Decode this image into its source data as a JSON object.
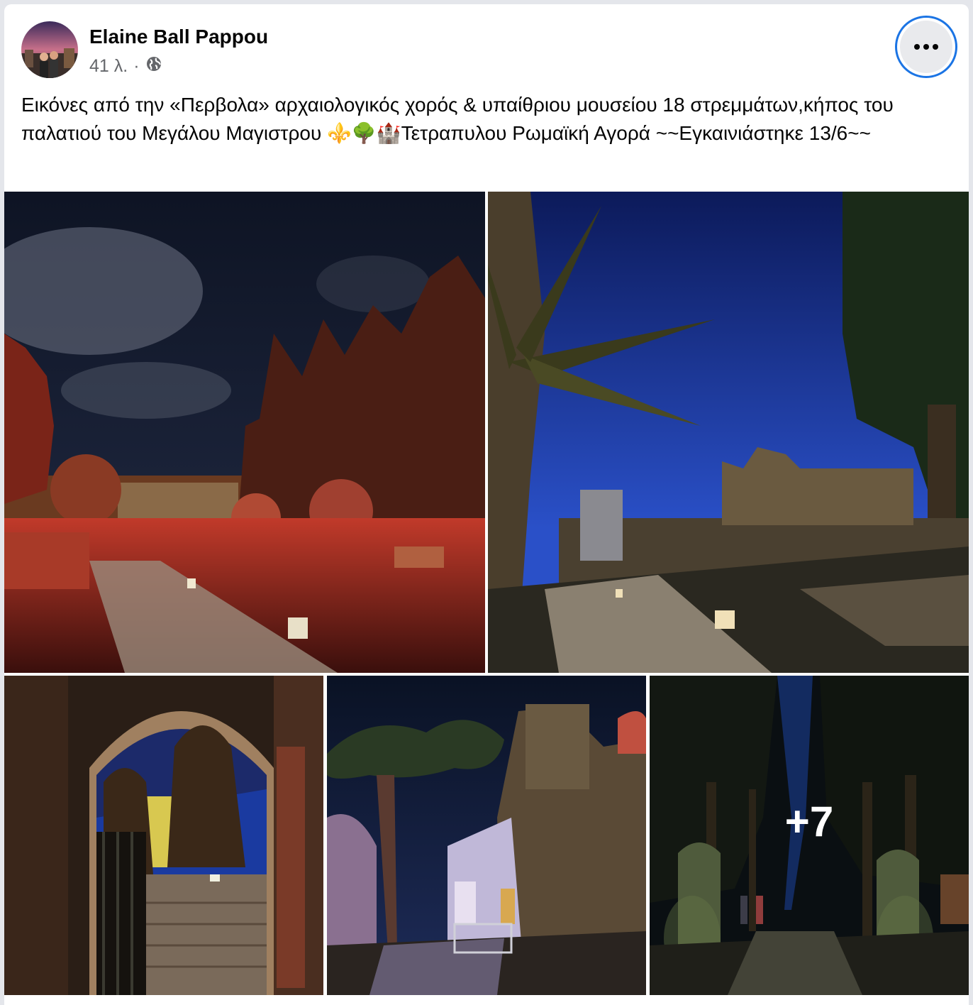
{
  "post": {
    "author": "Elaine Ball Pappou",
    "time": "41 λ.",
    "separator": "·",
    "privacy_icon": "globe-icon",
    "more_icon": "more-options-icon",
    "text": "Εικόνες από την «Περβολα» αρχαιολογικός χορός & υπαίθριου μουσείου 18 στρεμμάτων,κήπος του παλατιού του Μεγάλου Μαγιστρου ⚜️🌳🏰Τετραπυλου Ρωμαϊκή Αγορά ~~Εγκαινιάστηκε 13/6~~"
  },
  "photos": {
    "more_count": "+7"
  },
  "colors": {
    "accent": "#1b74e4",
    "text_primary": "#050505",
    "text_secondary": "#65676b"
  }
}
